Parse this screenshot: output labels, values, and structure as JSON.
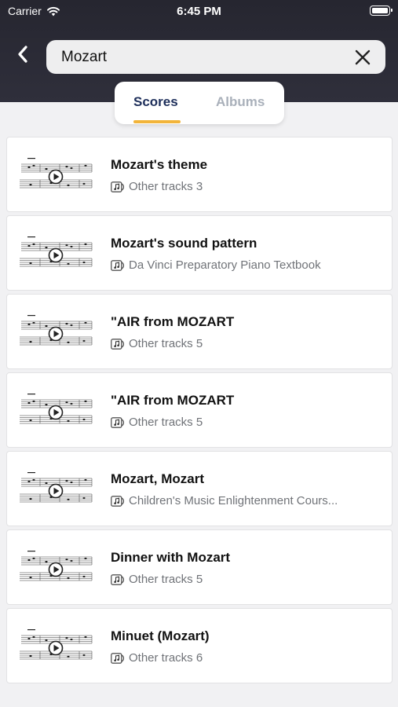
{
  "status_bar": {
    "carrier": "Carrier",
    "time": "6:45 PM"
  },
  "search": {
    "value": "Mozart",
    "placeholder": ""
  },
  "tabs": [
    {
      "label": "Scores",
      "active": true
    },
    {
      "label": "Albums",
      "active": false
    }
  ],
  "colors": {
    "header": "#2a2a35",
    "active_tab": "#1d2e5a",
    "inactive_tab": "#a9b0ba",
    "underline": "#f2b43a"
  },
  "results": [
    {
      "title": "Mozart's theme",
      "meta": "Other tracks 3"
    },
    {
      "title": "Mozart's sound pattern",
      "meta": "Da Vinci Preparatory Piano Textbook"
    },
    {
      "title": "\"AIR from MOZART",
      "meta": "Other tracks 5"
    },
    {
      "title": "\"AIR from MOZART",
      "meta": "Other tracks 5"
    },
    {
      "title": "Mozart, Mozart",
      "meta": "Children's Music Enlightenment Cours..."
    },
    {
      "title": "Dinner with Mozart",
      "meta": "Other tracks 5"
    },
    {
      "title": "Minuet (Mozart)",
      "meta": "Other tracks 6"
    }
  ]
}
